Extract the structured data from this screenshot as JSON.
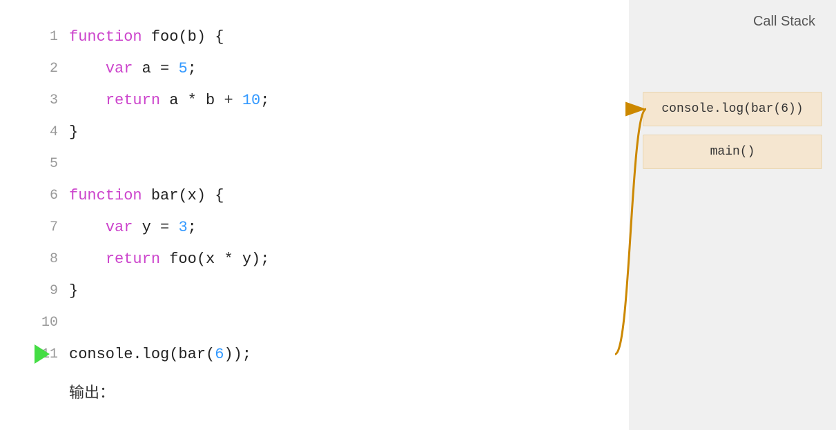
{
  "callstack": {
    "title": "Call Stack",
    "entries": [
      {
        "label": "console.log(bar(6))"
      },
      {
        "label": "main()"
      }
    ]
  },
  "code": {
    "lines": [
      {
        "num": "1",
        "tokens": [
          {
            "t": "kw",
            "v": "function"
          },
          {
            "t": "plain",
            "v": " foo(b) {"
          }
        ]
      },
      {
        "num": "2",
        "tokens": [
          {
            "t": "plain",
            "v": "    "
          },
          {
            "t": "var-kw",
            "v": "var"
          },
          {
            "t": "plain",
            "v": " a "
          },
          {
            "t": "sym",
            "v": "="
          },
          {
            "t": "plain",
            "v": " "
          },
          {
            "t": "num",
            "v": "5"
          },
          {
            "t": "plain",
            "v": ";"
          }
        ]
      },
      {
        "num": "3",
        "tokens": [
          {
            "t": "plain",
            "v": "    "
          },
          {
            "t": "kw",
            "v": "return"
          },
          {
            "t": "plain",
            "v": " a "
          },
          {
            "t": "sym",
            "v": "*"
          },
          {
            "t": "plain",
            "v": " b "
          },
          {
            "t": "sym",
            "v": "+"
          },
          {
            "t": "plain",
            "v": " "
          },
          {
            "t": "num",
            "v": "10"
          },
          {
            "t": "plain",
            "v": ";"
          }
        ]
      },
      {
        "num": "4",
        "tokens": [
          {
            "t": "plain",
            "v": "}"
          }
        ]
      },
      {
        "num": "5",
        "tokens": []
      },
      {
        "num": "6",
        "tokens": [
          {
            "t": "kw",
            "v": "function"
          },
          {
            "t": "plain",
            "v": " bar(x) {"
          }
        ]
      },
      {
        "num": "7",
        "tokens": [
          {
            "t": "plain",
            "v": "    "
          },
          {
            "t": "var-kw",
            "v": "var"
          },
          {
            "t": "plain",
            "v": " y "
          },
          {
            "t": "sym",
            "v": "="
          },
          {
            "t": "plain",
            "v": " "
          },
          {
            "t": "num",
            "v": "3"
          },
          {
            "t": "plain",
            "v": ";"
          }
        ]
      },
      {
        "num": "8",
        "tokens": [
          {
            "t": "plain",
            "v": "    "
          },
          {
            "t": "kw",
            "v": "return"
          },
          {
            "t": "plain",
            "v": " foo(x "
          },
          {
            "t": "sym",
            "v": "*"
          },
          {
            "t": "plain",
            "v": " y);"
          }
        ]
      },
      {
        "num": "9",
        "tokens": [
          {
            "t": "plain",
            "v": "}"
          }
        ]
      },
      {
        "num": "10",
        "tokens": []
      },
      {
        "num": "11",
        "tokens": [
          {
            "t": "plain",
            "v": "console.log(bar("
          },
          {
            "t": "num",
            "v": "6"
          },
          {
            "t": "plain",
            "v": "));"
          }
        ],
        "hasArrow": true
      }
    ]
  },
  "output_label": "输出："
}
